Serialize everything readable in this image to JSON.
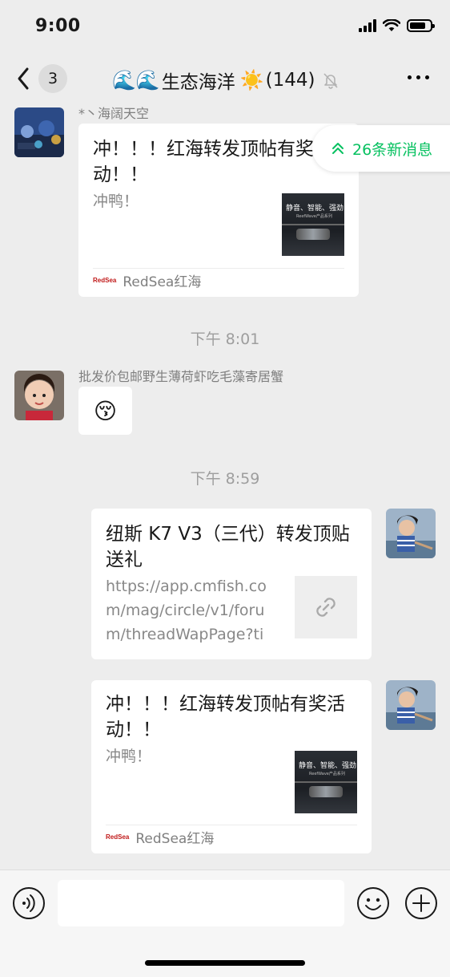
{
  "status_bar": {
    "time": "9:00",
    "battery_level": 0.8
  },
  "nav": {
    "back_badge": "3",
    "title_prefix": "🌊🌊",
    "title": "生态海洋",
    "title_sun": "☀️",
    "member_count": "(144)"
  },
  "messages": [
    {
      "sender": "*丶海阔天空",
      "card_title": "冲！！！红海转发顶帖有奖活动！！",
      "card_desc": "冲鸭！",
      "thumb_text": "静音、智能、强劲",
      "thumb_sub": "ReefWave产品系列",
      "source": "RedSea红海",
      "source_logo": "RedSea"
    },
    {
      "timestamp": "下午 8:01",
      "sender": "批发价包邮野生薄荷虾吃毛藻寄居蟹",
      "emoji": "😚"
    },
    {
      "timestamp": "下午 8:59",
      "card_title": "纽斯 K7 V3（三代）转发顶贴送礼",
      "link_url": "https://app.cmfish.com/mag/circle/v1/forum/threadWapPage?tid..."
    },
    {
      "card_title": "冲！！！红海转发顶帖有奖活动！！",
      "card_desc": "冲鸭！",
      "thumb_text": "静音、智能、强劲",
      "thumb_sub": "ReefWave产品系列",
      "source": "RedSea红海",
      "source_logo": "RedSea"
    }
  ],
  "new_messages": {
    "label": "26条新消息"
  },
  "input": {
    "placeholder": ""
  }
}
